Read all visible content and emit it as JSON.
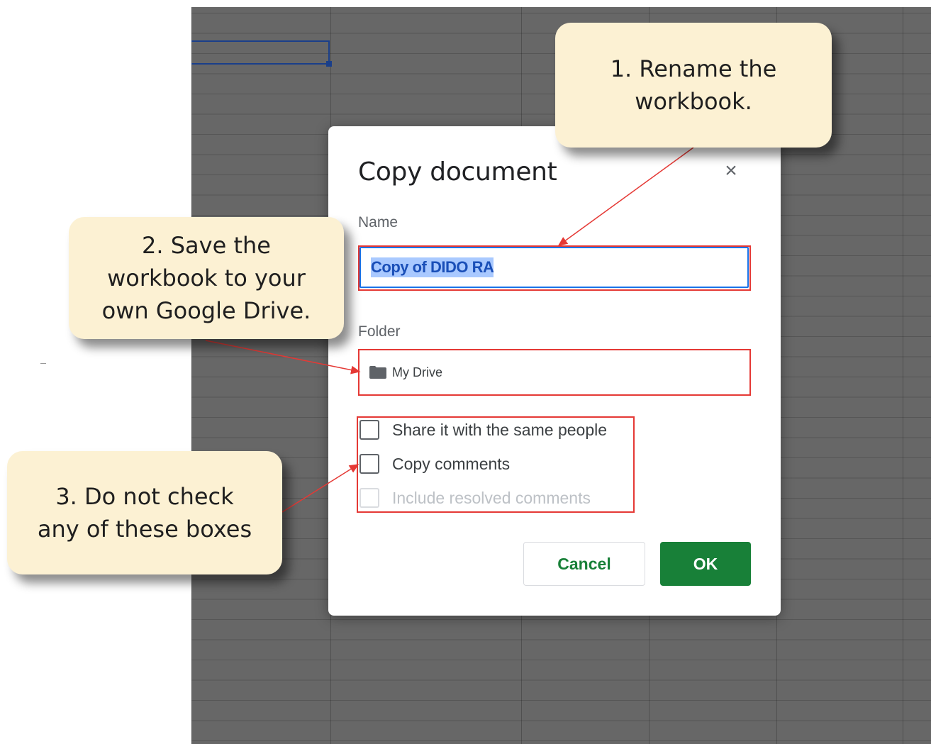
{
  "dialog": {
    "title": "Copy document",
    "close_glyph": "×",
    "name_label": "Name",
    "name_value": "Copy of DIDO RA",
    "folder_label": "Folder",
    "folder_value": "My Drive",
    "folder_icon": "folder-icon",
    "checkboxes": [
      {
        "label": "Share it with the same people",
        "checked": false,
        "enabled": true
      },
      {
        "label": "Copy comments",
        "checked": false,
        "enabled": true
      },
      {
        "label": "Include resolved comments",
        "checked": false,
        "enabled": false
      }
    ],
    "cancel_label": "Cancel",
    "ok_label": "OK"
  },
  "callouts": [
    {
      "text": "1. Rename the workbook."
    },
    {
      "text": "2. Save the workbook to your own Google Drive."
    },
    {
      "text": "3. Do not check any of these boxes"
    }
  ],
  "colors": {
    "accent_green": "#188038",
    "highlight_red": "#e53935",
    "selection_blue": "#1a73e8",
    "callout_bg": "#fcf1d3",
    "sheet_gray": "#676767"
  }
}
